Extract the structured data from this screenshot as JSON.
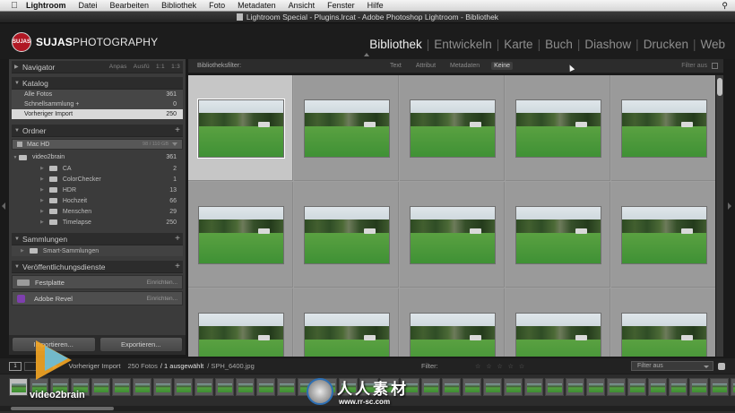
{
  "menubar": {
    "app": "Lightroom",
    "items": [
      "Datei",
      "Bearbeiten",
      "Bibliothek",
      "Foto",
      "Metadaten",
      "Ansicht",
      "Fenster",
      "Hilfe"
    ]
  },
  "window_title": "Lightroom Special - Plugins.lrcat - Adobe Photoshop Lightroom - Bibliothek",
  "identity": {
    "badge": "SUJAS",
    "brand_bold": "SUJAS",
    "brand_rest": "PHOTOGRAPHY"
  },
  "modules": {
    "items": [
      {
        "label": "Bibliothek",
        "active": true
      },
      {
        "label": "Entwickeln",
        "active": false
      },
      {
        "label": "Karte",
        "active": false
      },
      {
        "label": "Buch",
        "active": false
      },
      {
        "label": "Diashow",
        "active": false
      },
      {
        "label": "Drucken",
        "active": false
      },
      {
        "label": "Web",
        "active": false
      }
    ]
  },
  "navigator": {
    "title": "Navigator",
    "options": [
      "Anpas",
      "Ausfü",
      "1:1",
      "1:3"
    ]
  },
  "catalog": {
    "title": "Katalog",
    "rows": [
      {
        "label": "Alle Fotos",
        "count": "361",
        "selected": false
      },
      {
        "label": "Schnellsammlung +",
        "count": "0",
        "selected": false
      },
      {
        "label": "Vorheriger Import",
        "count": "250",
        "selected": true
      }
    ]
  },
  "folders": {
    "title": "Ordner",
    "volume": {
      "label": "Mac HD",
      "size": "98 / 110 GB"
    },
    "root": {
      "label": "video2brain",
      "count": "361"
    },
    "subfolders": [
      {
        "label": "CA",
        "count": "2"
      },
      {
        "label": "ColorChecker",
        "count": "1"
      },
      {
        "label": "HDR",
        "count": "13"
      },
      {
        "label": "Hochzeit",
        "count": "66"
      },
      {
        "label": "Menschen",
        "count": "29"
      },
      {
        "label": "Timelapse",
        "count": "250"
      }
    ]
  },
  "collections": {
    "title": "Sammlungen",
    "smart": "Smart-Sammlungen"
  },
  "publish": {
    "title": "Veröffentlichungsdienste",
    "services": [
      {
        "label": "Festplatte",
        "action": "Einrichten..."
      },
      {
        "label": "Adobe Revel",
        "action": "Einrichten..."
      }
    ]
  },
  "buttons": {
    "import": "Importieren...",
    "export": "Exportieren..."
  },
  "filterbar": {
    "label": "Bibliotheksfilter:",
    "tabs": [
      {
        "label": "Text",
        "active": false
      },
      {
        "label": "Attribut",
        "active": false
      },
      {
        "label": "Metadaten",
        "active": false
      },
      {
        "label": "Keine",
        "active": true
      }
    ],
    "right": "Filter aus"
  },
  "grid": {
    "columns": 5,
    "rows_visible": 3,
    "selected_index": 0
  },
  "filmstrip_bar": {
    "page1": "1",
    "source": "Vorheriger Import",
    "count": "250 Fotos",
    "selected": "/ 1 ausgewählt",
    "filename": "/ SPH_6400.jpg",
    "filter_label": "Filter:",
    "stars": "☆ ☆ ☆ ☆ ☆",
    "filter_select": "Filter aus"
  },
  "filmstrip": {
    "frames": 37
  },
  "watermarks": {
    "video2brain": "video2brain",
    "cn": "人人素材",
    "url": "www.rr-sc.com"
  },
  "colors": {
    "accent_red": "#b01824",
    "grass": "#3f9135"
  }
}
